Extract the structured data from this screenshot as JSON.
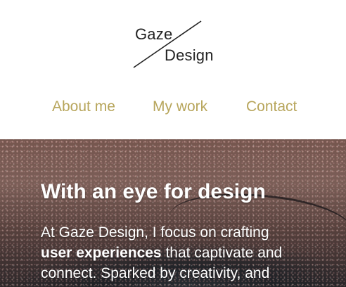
{
  "logo": {
    "line1": "Gaze",
    "line2": "Design"
  },
  "nav": {
    "items": [
      {
        "label": "About me"
      },
      {
        "label": "My work"
      },
      {
        "label": "Contact"
      }
    ],
    "color": "#b7a55b"
  },
  "hero": {
    "heading": "With an eye for design",
    "text_1": "At Gaze Design, I focus on crafting",
    "text_bold": "user experiences",
    "text_2": " that captivate and",
    "text_3": "connect. Sparked by creativity, and"
  }
}
